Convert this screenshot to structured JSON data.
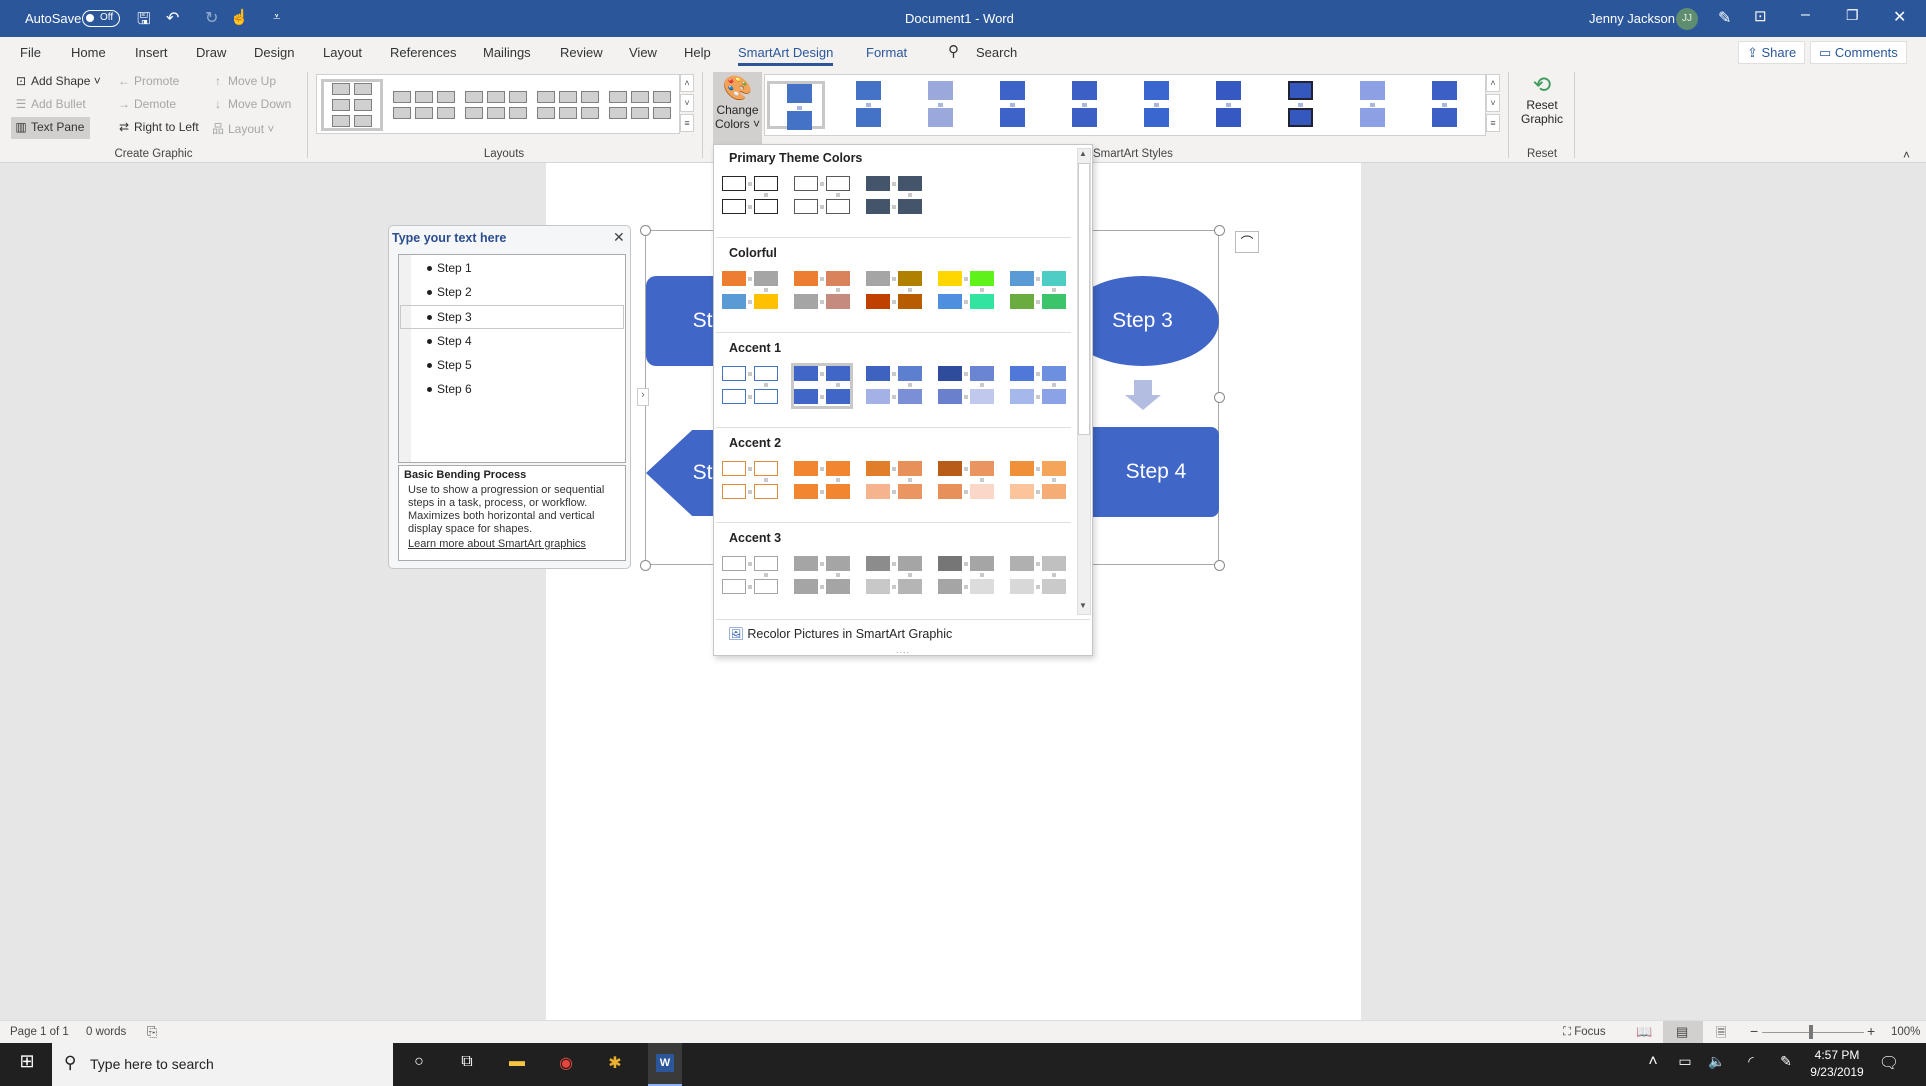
{
  "titlebar": {
    "autosave": "AutoSave",
    "autosave_state": "Off",
    "title": "Document1 - Word",
    "user": "Jenny Jackson",
    "initials": "JJ"
  },
  "tabs": [
    "File",
    "Home",
    "Insert",
    "Draw",
    "Design",
    "Layout",
    "References",
    "Mailings",
    "Review",
    "View",
    "Help",
    "SmartArt Design",
    "Format"
  ],
  "active_tab": "SmartArt Design",
  "search": "Search",
  "share": "Share",
  "comments": "Comments",
  "ribbon": {
    "create_graphic": {
      "label": "Create Graphic",
      "add_shape": "Add Shape",
      "promote": "Promote",
      "move_up": "Move Up",
      "add_bullet": "Add Bullet",
      "demote": "Demote",
      "move_down": "Move Down",
      "text_pane": "Text Pane",
      "right_to_left": "Right to Left",
      "layout": "Layout"
    },
    "layouts": {
      "label": "Layouts",
      "count": 5
    },
    "change_colors": [
      "Change",
      "Colors"
    ],
    "styles": {
      "label": "SmartArt Styles",
      "count": 10
    },
    "reset": {
      "label": "Reset",
      "button": [
        "Reset",
        "Graphic"
      ]
    }
  },
  "textpane": {
    "title": "Type your text here",
    "items": [
      "Step 1",
      "Step 2",
      "Step 3",
      "Step 4",
      "Step 5",
      "Step 6"
    ],
    "selected": "Step 3",
    "desc_title": "Basic Bending Process",
    "desc": "Use to show a progression or sequential steps in a task, process, or workflow. Maximizes both horizontal and vertical display space for shapes.",
    "link": "Learn more about SmartArt graphics"
  },
  "smartart": {
    "shapes": [
      "Step 1",
      "Step 3",
      "Step 4",
      "Step 5"
    ],
    "color": "#4066c8"
  },
  "colors_menu": {
    "sections": [
      {
        "title": "Primary Theme Colors",
        "swatches": [
          {
            "outline": "#262626",
            "c": [
              "#fff",
              "#fff",
              "#fff",
              "#fff"
            ]
          },
          {
            "outline": "#595959",
            "c": [
              "#fff",
              "#fff",
              "#fff",
              "#fff"
            ]
          },
          {
            "c": [
              "#44546a",
              "#44546a",
              "#44546a",
              "#44546a"
            ]
          }
        ]
      },
      {
        "title": "Colorful",
        "swatches": [
          {
            "c": [
              "#ed7d31",
              "#a5a5a5",
              "#5b9bd5",
              "#ffc000"
            ]
          },
          {
            "c": [
              "#ed7d31",
              "#d9825b",
              "#a5a5a5",
              "#c48b7e"
            ]
          },
          {
            "c": [
              "#a5a5a5",
              "#b08100",
              "#c04000",
              "#b85c00"
            ]
          },
          {
            "c": [
              "#ffd700",
              "#5ef21a",
              "#4f8fe0",
              "#33e3a0"
            ]
          },
          {
            "c": [
              "#5b9bd5",
              "#4ecdc4",
              "#6aac3f",
              "#3cc46a"
            ]
          }
        ]
      },
      {
        "title": "Accent 1",
        "swatches": [
          {
            "outline": "#4472c4",
            "c": [
              "#fff",
              "#fff",
              "#fff",
              "#fff"
            ]
          },
          {
            "selected": true,
            "c": [
              "#4066c8",
              "#4066c8",
              "#4066c8",
              "#4066c8"
            ]
          },
          {
            "c": [
              "#3d62c0",
              "#5c7fd0",
              "#a3b1e6",
              "#7a8fd6"
            ]
          },
          {
            "c": [
              "#2f4b9b",
              "#6a85d4",
              "#6a80cc",
              "#c0c8ee"
            ]
          },
          {
            "c": [
              "#4f78d8",
              "#6d8fe0",
              "#a5b8ec",
              "#8ba3e6"
            ]
          }
        ]
      },
      {
        "title": "Accent 2",
        "swatches": [
          {
            "outline": "#e08a3a",
            "c": [
              "#fff",
              "#fff",
              "#fff",
              "#fff"
            ]
          },
          {
            "c": [
              "#f28530",
              "#f28530",
              "#f28530",
              "#f28530"
            ]
          },
          {
            "c": [
              "#e07e2a",
              "#e8905a",
              "#f5b38e",
              "#eb9560"
            ]
          },
          {
            "c": [
              "#b85c1a",
              "#ea9560",
              "#e8905a",
              "#fbd7c7"
            ]
          },
          {
            "c": [
              "#f0913a",
              "#f5a55a",
              "#fbc49a",
              "#f5ad75"
            ]
          }
        ]
      },
      {
        "title": "Accent 3",
        "swatches": [
          {
            "outline": "#a5a5a5",
            "c": [
              "#fff",
              "#fff",
              "#fff",
              "#fff"
            ]
          },
          {
            "c": [
              "#a5a5a5",
              "#a5a5a5",
              "#a5a5a5",
              "#a5a5a5"
            ]
          },
          {
            "c": [
              "#8c8c8c",
              "#a5a5a5",
              "#c8c8c8",
              "#b5b5b5"
            ]
          },
          {
            "c": [
              "#767676",
              "#a5a5a5",
              "#a5a5a5",
              "#dcdcdc"
            ]
          },
          {
            "c": [
              "#b0b0b0",
              "#c0c0c0",
              "#d8d8d8",
              "#cacaca"
            ]
          }
        ]
      }
    ],
    "recolor": "Recolor Pictures in SmartArt Graphic"
  },
  "status": {
    "page": "Page 1 of 1",
    "words": "0 words",
    "focus": "Focus",
    "zoom": "100%",
    "zoom_value": 100
  },
  "taskbar": {
    "search_placeholder": "Type here to search",
    "time": "4:57 PM",
    "date": "9/23/2019"
  }
}
